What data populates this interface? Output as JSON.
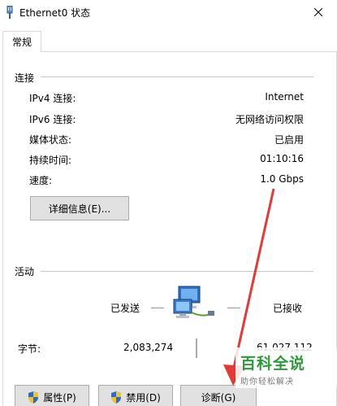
{
  "window": {
    "title": "Ethernet0 状态",
    "icon": "network-adapter-icon"
  },
  "tabs": [
    {
      "label": "常规",
      "selected": true
    }
  ],
  "connection": {
    "group_label": "连接",
    "rows": [
      {
        "label": "IPv4 连接:",
        "value": "Internet"
      },
      {
        "label": "IPv6 连接:",
        "value": "无网络访问权限"
      },
      {
        "label": "媒体状态:",
        "value": "已启用"
      },
      {
        "label": "持续时间:",
        "value": "01:10:16"
      },
      {
        "label": "速度:",
        "value": "1.0 Gbps"
      }
    ],
    "details_button": "详细信息(E)..."
  },
  "activity": {
    "group_label": "活动",
    "sent_label": "已发送",
    "received_label": "已接收",
    "bytes_label": "字节:",
    "bytes_sent": "2,083,274",
    "bytes_received": "61,027,112",
    "icon": "network-computers-icon"
  },
  "buttons": {
    "properties": "属性(P)",
    "disable": "禁用(D)",
    "diagnose": "诊断(G)"
  },
  "watermark": {
    "title": "百科全说",
    "subtitle": "助你轻松解决"
  },
  "colors": {
    "annotation_arrow": "#e53935",
    "watermark_green": "#2d9a3a"
  }
}
